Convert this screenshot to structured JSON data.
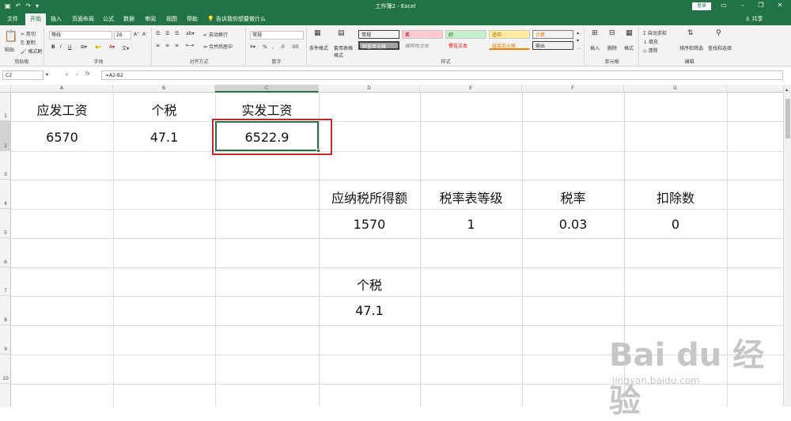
{
  "window": {
    "title": "工作簿2 - Excel",
    "login_label": "登录",
    "accent": "#217346"
  },
  "qat": {
    "save_icon": "save-icon",
    "undo_icon": "undo-icon",
    "redo_icon": "redo-icon"
  },
  "menu": {
    "tabs": [
      "文件",
      "开始",
      "插入",
      "页面布局",
      "公式",
      "数据",
      "审阅",
      "视图",
      "帮助"
    ],
    "active": "开始",
    "tell_me": "告诉我你想要做什么",
    "share": "共享"
  },
  "ribbon": {
    "clipboard": {
      "label": "剪贴板",
      "paste": "粘贴",
      "cut": "剪切",
      "copy": "复制",
      "format_painter": "格式刷"
    },
    "font": {
      "label": "字体",
      "name": "等线",
      "size": "26",
      "bold": "B",
      "italic": "I",
      "underline": "U"
    },
    "alignment": {
      "label": "对齐方式",
      "wrap": "自动换行",
      "merge": "合并后居中"
    },
    "number": {
      "label": "数字",
      "format": "常规"
    },
    "styles": {
      "label": "样式",
      "conditional": "条件格式",
      "table": "套用表格格式",
      "cells": [
        {
          "text": "常规",
          "bg": "#ffffff",
          "color": "#000000"
        },
        {
          "text": "差",
          "bg": "#ffc7ce",
          "color": "#9c0006"
        },
        {
          "text": "好",
          "bg": "#c6efce",
          "color": "#006100"
        },
        {
          "text": "适中",
          "bg": "#ffeb9c",
          "color": "#9c5700"
        },
        {
          "text": "计算",
          "bg": "#f2f2f2",
          "color": "#fa7d00"
        },
        {
          "text": "检查单元格",
          "bg": "#a5a5a5",
          "color": "#ffffff"
        },
        {
          "text": "解释性文本",
          "bg": "#ffffff",
          "color": "#7f7f7f"
        },
        {
          "text": "警告文本",
          "bg": "#ffffff",
          "color": "#ff0000"
        },
        {
          "text": "链接单元格",
          "bg": "#ffffff",
          "color": "#fa7d00"
        },
        {
          "text": "输出",
          "bg": "#f2f2f2",
          "color": "#3f3f3f"
        }
      ]
    },
    "cells": {
      "label": "单元格",
      "insert": "插入",
      "delete": "删除",
      "format": "格式"
    },
    "editing": {
      "label": "编辑",
      "autosum": "自动求和",
      "fill": "填充",
      "clear": "清除",
      "sort": "排序和筛选",
      "find": "查找和选择"
    }
  },
  "formula_bar": {
    "name_box": "C2",
    "fx": "fx",
    "formula": "=A2-B2"
  },
  "grid": {
    "columns": [
      "A",
      "B",
      "C",
      "D",
      "E",
      "F",
      "G"
    ],
    "selected_column": "C",
    "rows": [
      "1",
      "2",
      "3",
      "4",
      "5",
      "6",
      "7",
      "8",
      "9",
      "10"
    ],
    "selected_row": "2",
    "cells": {
      "A1": "应发工资",
      "B1": "个税",
      "C1": "实发工资",
      "A2": "6570",
      "B2": "47.1",
      "C2": "6522.9",
      "D4": "应纳税所得额",
      "E4": "税率表等级",
      "F4": "税率",
      "G4": "扣除数",
      "D5": "1570",
      "E5": "1",
      "F5": "0.03",
      "G5": "0",
      "D7": "个税",
      "D8": "47.1"
    },
    "selected_cell": "C2"
  },
  "watermark": {
    "brand": "Bai du 经验",
    "url": "jingyan.baidu.com"
  }
}
